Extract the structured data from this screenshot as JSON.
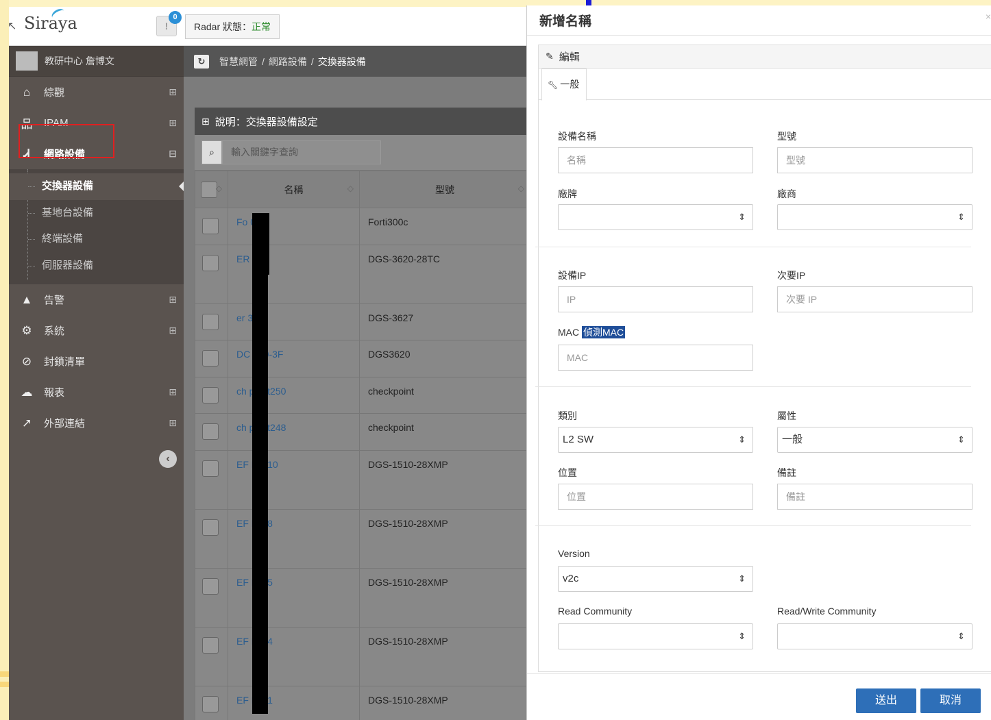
{
  "topbar": {
    "logo": "Siraya",
    "notif_count": "0",
    "radar_label": "Radar 狀態：",
    "radar_value": "正常"
  },
  "sidebar": {
    "user": "教研中心 詹博文",
    "items": [
      {
        "label": "綜觀",
        "icon": "home-icon"
      },
      {
        "label": "IPAM",
        "icon": "sitemap-icon"
      },
      {
        "label": "網路設備",
        "icon": "network-icon"
      },
      {
        "label": "告警",
        "icon": "warning-icon"
      },
      {
        "label": "系統",
        "icon": "gears-icon"
      },
      {
        "label": "封鎖清單",
        "icon": "ban-icon"
      },
      {
        "label": "報表",
        "icon": "cloud-icon"
      },
      {
        "label": "外部連結",
        "icon": "external-link-icon"
      }
    ],
    "subitems": [
      "交換器設備",
      "基地台設備",
      "終端設備",
      "伺服器設備"
    ]
  },
  "breadcrumb": {
    "items": [
      "智慧網管",
      "網路設備"
    ],
    "current": "交換器設備"
  },
  "panel": {
    "title": "說明：交換器設備設定",
    "search_placeholder": "輸入關鍵字查詢",
    "columns": [
      "名稱",
      "型號"
    ],
    "rows": [
      {
        "name": "Fo      0c",
        "model": "Forti300c"
      },
      {
        "name": "ER      L3",
        "model": "DGS-3620-28TC"
      },
      {
        "name": "er      3",
        "model": "DGS-3627"
      },
      {
        "name": "DC     620-3F",
        "model": "DGS3620"
      },
      {
        "name": "ch      point250",
        "model": "checkpoint"
      },
      {
        "name": "ch      point248",
        "model": "checkpoint"
      },
      {
        "name": "EF      L2010",
        "model": "DGS-1510-28XMP"
      },
      {
        "name": "EF      L208",
        "model": "DGS-1510-28XMP"
      },
      {
        "name": "EF      L205",
        "model": "DGS-1510-28XMP"
      },
      {
        "name": "EF      L204",
        "model": "DGS-1510-28XMP"
      },
      {
        "name": "EF      L201",
        "model": "DGS-1510-28XMP"
      }
    ]
  },
  "modal": {
    "title": "新增名稱",
    "close": "×",
    "edit_label": "編輯",
    "tab_general": "一般",
    "device_name_label": "設備名稱",
    "device_name_placeholder": "名稱",
    "model_label": "型號",
    "model_placeholder": "型號",
    "brand_label": "廠牌",
    "vendor_label": "廠商",
    "ip_label": "設備IP",
    "ip_placeholder": "IP",
    "secondary_ip_label": "次要IP",
    "secondary_ip_placeholder": "次要 IP",
    "mac_label": "MAC",
    "detect_mac": "偵測MAC",
    "mac_placeholder": "MAC",
    "category_label": "類別",
    "category_value": "L2 SW",
    "attribute_label": "屬性",
    "attribute_value": "一般",
    "location_label": "位置",
    "location_placeholder": "位置",
    "note_label": "備註",
    "note_placeholder": "備註",
    "version_label": "Version",
    "version_value": "v2c",
    "read_community_label": "Read Community",
    "rw_community_label": "Read/Write Community",
    "submit": "送出",
    "cancel": "取消"
  },
  "colors": {
    "accent": "#2e6fb8",
    "sidebar_bg": "#5a534f",
    "highlight_border": "#e02020"
  }
}
